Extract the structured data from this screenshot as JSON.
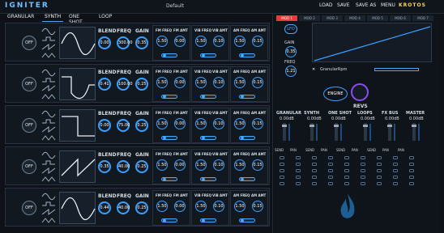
{
  "app": {
    "logo_part1": "IGNITER",
    "logo_part2": "",
    "preset": "Default",
    "brand": "KROTOS"
  },
  "nav": [
    "LOAD",
    "SAVE",
    "SAVE AS",
    "MENU"
  ],
  "tabs": [
    "GRANULAR",
    "SYNTH",
    "ONE SHOT",
    "LOOP"
  ],
  "active_tab": "SYNTH",
  "colors": {
    "accent": "#38a0ff",
    "background": "#0e1218",
    "active_lfo": "#e83a3a"
  },
  "engines": [
    {
      "off": "OFF",
      "blend": "0.00",
      "freq": "300.00",
      "gain": "0.35",
      "wave": "sine",
      "fm_freq": "1.50",
      "fm_amt": "0.00",
      "vib_freq": "1.50",
      "vib_amt": "0.10",
      "am_freq": "1.50",
      "am_amt": "0.15"
    },
    {
      "off": "OFF",
      "blend": "0.41",
      "freq": "100.00",
      "gain": "0.25",
      "wave": "square-sine",
      "fm_freq": "1.50",
      "fm_amt": "0.00",
      "vib_freq": "1.50",
      "vib_amt": "0.10",
      "am_freq": "1.50",
      "am_amt": "0.15"
    },
    {
      "off": "OFF",
      "blend": "0.00",
      "freq": "75.00",
      "gain": "0.25",
      "wave": "square",
      "fm_freq": "1.50",
      "fm_amt": "0.00",
      "vib_freq": "1.50",
      "vib_amt": "0.10",
      "am_freq": "1.50",
      "am_amt": "0.15"
    },
    {
      "off": "OFF",
      "blend": "0.35",
      "freq": "40.00",
      "gain": "0.25",
      "wave": "saw",
      "fm_freq": "1.50",
      "fm_amt": "0.00",
      "vib_freq": "1.50",
      "vib_amt": "0.10",
      "am_freq": "1.50",
      "am_amt": "0.15"
    },
    {
      "off": "OFF",
      "blend": "0.44",
      "freq": "40.00",
      "gain": "0.25",
      "wave": "sine",
      "fm_freq": "1.50",
      "fm_amt": "0.00",
      "vib_freq": "1.50",
      "vib_amt": "0.10",
      "am_freq": "1.50",
      "am_amt": "0.15"
    }
  ],
  "labels": {
    "blend": "BLEND",
    "freq": "FREQ",
    "gain": "GAIN",
    "fm_freq": "FM FREQ",
    "fm_amt": "FM AMT",
    "vib_freq": "VIB FREQ",
    "vib_amt": "VIB AMT",
    "am_freq": "AM FREQ",
    "am_amt": "AM AMT"
  },
  "lfo_tabs": [
    "MOD 1",
    "MOD 2",
    "MOD 3",
    "MOD 4",
    "MOD 5",
    "MOD 6",
    "MOD 7"
  ],
  "lfo": {
    "mode": "LFO",
    "gain_label": "GAIN",
    "gain_value": "0.35",
    "freq_label": "FREQ",
    "freq_value": "1.21",
    "target": "GranularRpm"
  },
  "engine_btn": "ENGINE",
  "revs_label": "REVS",
  "mixer": [
    {
      "name": "GRANULAR",
      "db": "0.00dB"
    },
    {
      "name": "SYNTH",
      "db": "0.00dB"
    },
    {
      "name": "ONE SHOT",
      "db": "0.00dB"
    },
    {
      "name": "LOOPS",
      "db": "0.00dB"
    },
    {
      "name": "FX BUS",
      "db": "0.00dB"
    },
    {
      "name": "MASTER",
      "db": "0.00dB"
    }
  ],
  "send_pan": [
    "SEND",
    "PAN",
    "SEND",
    "PAN",
    "SEND",
    "PAN",
    "SEND",
    "PAN",
    "PAN"
  ]
}
